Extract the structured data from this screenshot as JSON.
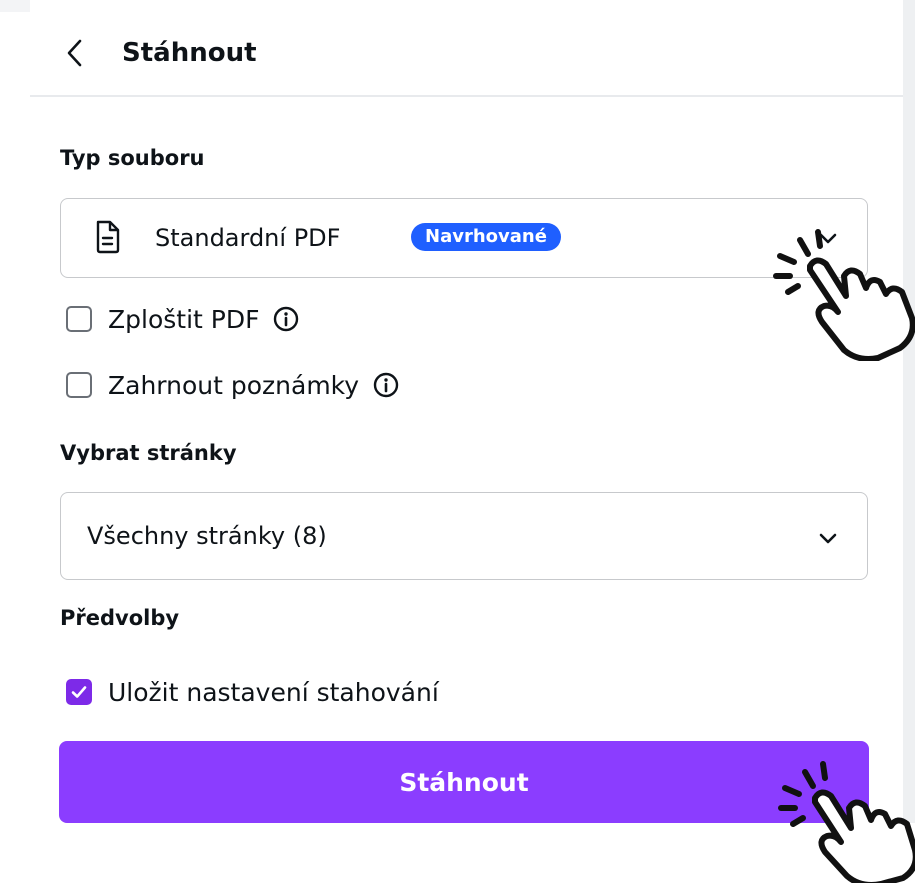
{
  "header": {
    "title": "Stáhnout"
  },
  "file_type": {
    "label": "Typ souboru",
    "selected": "Standardní PDF",
    "badge": "Navrhované"
  },
  "options": {
    "flatten_pdf": {
      "label": "Zploštit PDF",
      "checked": false
    },
    "include_notes": {
      "label": "Zahrnout poznámky",
      "checked": false
    }
  },
  "pages": {
    "label": "Vybrat stránky",
    "selected": "Všechny stránky (8)"
  },
  "presets": {
    "label": "Předvolby",
    "save_settings": {
      "label": "Uložit nastavení stahování",
      "checked": true
    }
  },
  "actions": {
    "download_label": "Stáhnout"
  },
  "colors": {
    "accent": "#8b3dff",
    "checkbox_checked": "#7d2ae8",
    "badge": "#1f5fff"
  }
}
